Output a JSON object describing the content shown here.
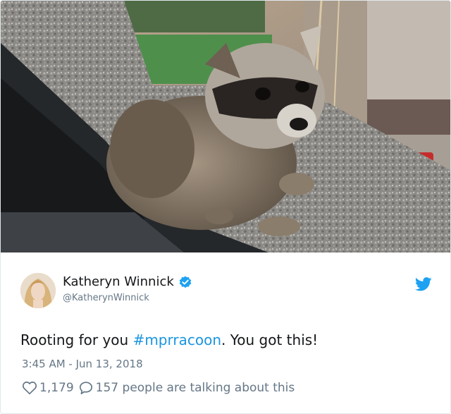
{
  "photo": {
    "alt_icon": "raccoon-photo"
  },
  "author": {
    "display_name": "Katheryn Winnick",
    "handle": "@KatherynWinnick",
    "verified_icon": "verified-badge-icon",
    "avatar_icon": "avatar"
  },
  "tweet": {
    "text_before": "Rooting for you ",
    "hashtag": "#mprracoon",
    "text_after": ". You got this!",
    "timestamp": "3:45 AM - Jun 13, 2018"
  },
  "actions": {
    "likes": "1,179",
    "conversation": "157 people are talking about this"
  },
  "colors": {
    "accent": "#1da1f2",
    "hashtag": "#1b95e0",
    "muted": "#657786",
    "text": "#14171a"
  }
}
